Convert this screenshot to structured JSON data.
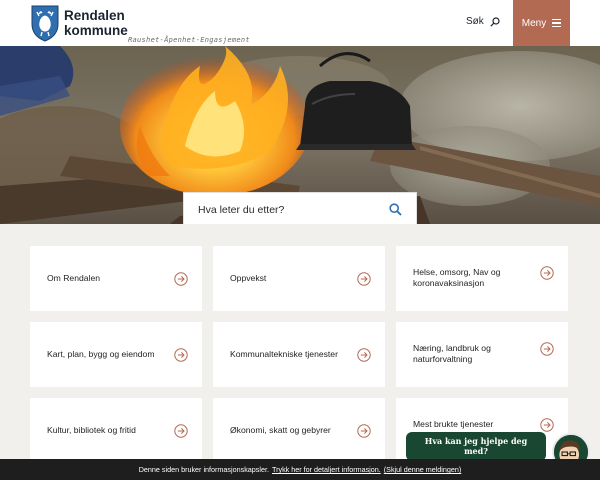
{
  "header": {
    "brand_line1": "Rendalen",
    "brand_line2": "kommune",
    "slogan": "Raushet-Åpenhet-Engasjement",
    "search_label": "Søk",
    "menu_label": "Meny",
    "accent_color": "#b36a53"
  },
  "hero": {
    "search_placeholder": "Hva leter du etter?"
  },
  "cards": [
    {
      "label": "Om Rendalen"
    },
    {
      "label": "Oppvekst"
    },
    {
      "label": "Helse, omsorg, Nav og koronavaksinasjon"
    },
    {
      "label": "Kart, plan, bygg og eiendom"
    },
    {
      "label": "Kommunaltekniske tjenester"
    },
    {
      "label": "Næring, landbruk og naturforvaltning"
    },
    {
      "label": "Kultur, bibliotek og fritid"
    },
    {
      "label": "Økonomi, skatt og gebyrer"
    },
    {
      "label": "Mest brukte tjenester"
    }
  ],
  "chat": {
    "prompt_line1": "Hva kan jeg hjelpe deg",
    "prompt_line2": "med?",
    "color": "#1a4732"
  },
  "cookie_bar": {
    "text": "Denne siden bruker informasjonskapsler.",
    "details_link": "Trykk her for detaljert informasjon.",
    "hide_link": "(Skjul denne meldingen)"
  },
  "icons": {
    "logo": "coat-of-arms-icon",
    "search": "search-icon",
    "menu": "hamburger-icon",
    "card_arrow": "arrow-right-circle-icon",
    "chat": "chatbot-avatar-icon"
  }
}
